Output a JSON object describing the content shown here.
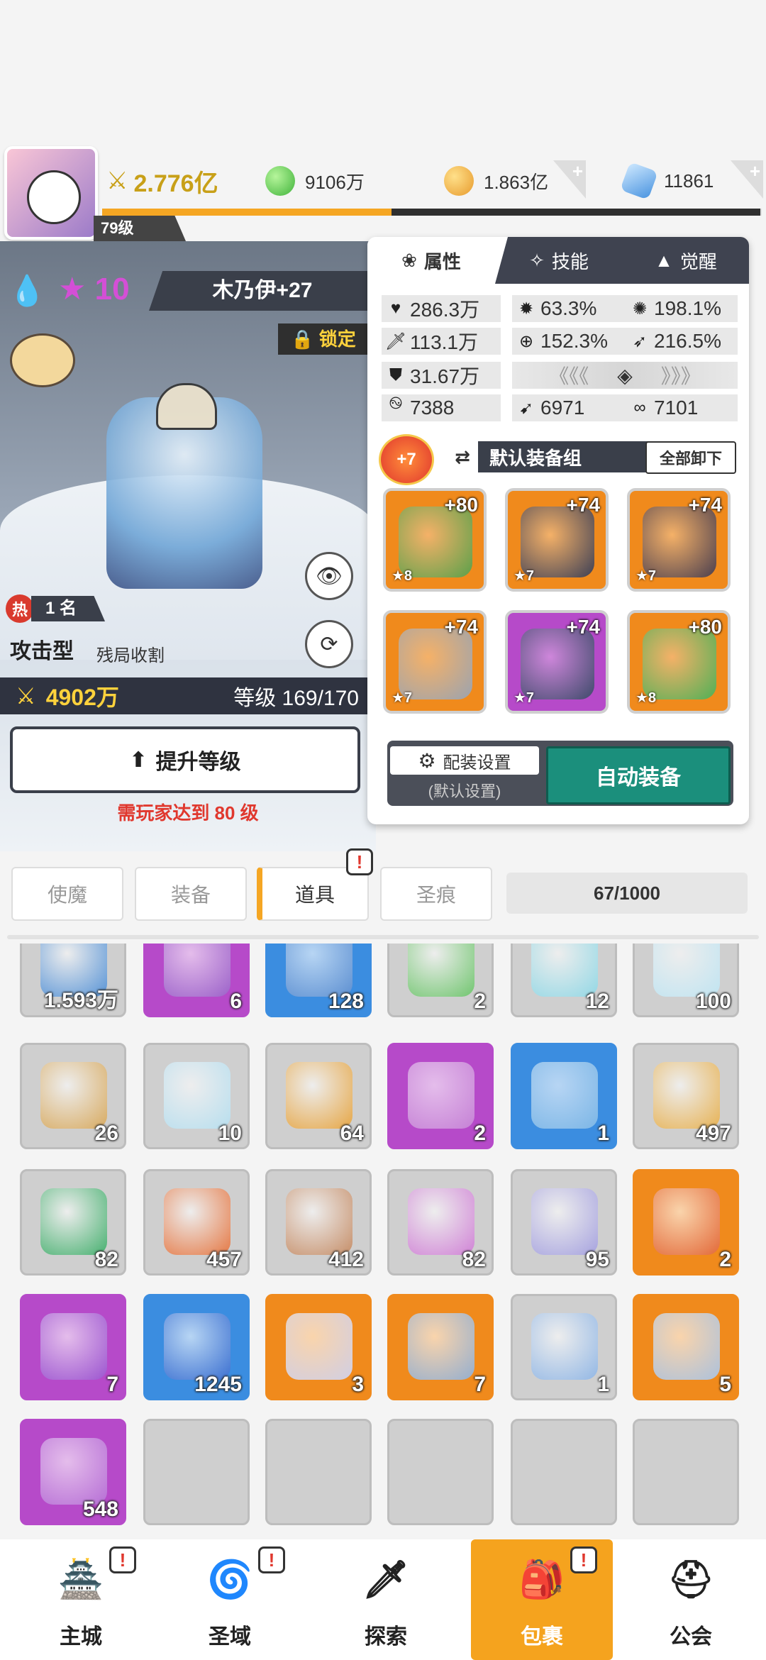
{
  "header": {
    "level": "79级",
    "power": "2.776亿",
    "currencies": [
      {
        "icon": "green-gem-icon",
        "value": "9106万"
      },
      {
        "icon": "gold-coin-icon",
        "value": "1.863亿"
      },
      {
        "icon": "blue-crystal-icon",
        "value": "11861"
      }
    ],
    "xp_progress": 0.5
  },
  "hero": {
    "stars": "10",
    "name": "木乃伊+27",
    "lock_label": "锁定",
    "rank_label": "热",
    "rank_value": "1 名",
    "type": "攻击型",
    "subtype": "残局收割",
    "power": "4902万",
    "level_text": "等级 169/170",
    "upgrade_label": "提升等级",
    "requirement": "需玩家达到 80 级"
  },
  "panel": {
    "tabs": [
      "属性",
      "技能",
      "觉醒"
    ],
    "stats": {
      "hp": "286.3万",
      "crit": "63.3%",
      "crit_dmg": "198.1%",
      "atk": "113.1万",
      "acc": "152.3%",
      "speed": "216.5%",
      "def": "31.67万",
      "s1": "7388",
      "s2": "6971",
      "s3": "7101"
    },
    "equip_badge": "+7",
    "equip_group": "默认装备组",
    "unequip_all": "全部卸下",
    "slots": [
      {
        "plus": "+80",
        "star": "★8",
        "frame": "#f08a1c",
        "art": "#5aa04a"
      },
      {
        "plus": "+74",
        "star": "★7",
        "frame": "#f08a1c",
        "art": "#3c3f55"
      },
      {
        "plus": "+74",
        "star": "★7",
        "frame": "#f08a1c",
        "art": "#4a3e4e"
      },
      {
        "plus": "+74",
        "star": "★7",
        "frame": "#f08a1c",
        "art": "#9aa3b0"
      },
      {
        "plus": "+74",
        "star": "★7",
        "frame": "#b64ac9",
        "art": "#3d4a6a"
      },
      {
        "plus": "+80",
        "star": "★8",
        "frame": "#f08a1c",
        "art": "#4fb056"
      }
    ],
    "config_label": "配装设置",
    "config_sub": "(默认设置)",
    "auto_equip": "自动装备"
  },
  "inventory": {
    "tabs": [
      "使魔",
      "装备",
      "道具",
      "圣痕"
    ],
    "active_tab": "道具",
    "capacity": "67/1000",
    "items": [
      {
        "count": "1.593万",
        "frame": "#d0d0d0",
        "art": "#4f8fd6"
      },
      {
        "count": "6",
        "frame": "#b64ac9",
        "art": "#9a63c9"
      },
      {
        "count": "128",
        "frame": "#3b8de0",
        "art": "#5e8fd0"
      },
      {
        "count": "2",
        "frame": "#d0d0d0",
        "art": "#6cc56a"
      },
      {
        "count": "12",
        "frame": "#d0d0d0",
        "art": "#8fd8e6"
      },
      {
        "count": "100",
        "frame": "#d0d0d0",
        "art": "#bfe5f3"
      },
      {
        "count": "26",
        "frame": "#d0d0d0",
        "art": "#d8a85a"
      },
      {
        "count": "10",
        "frame": "#d0d0d0",
        "art": "#b6dff0"
      },
      {
        "count": "64",
        "frame": "#d0d0d0",
        "art": "#e7a43e"
      },
      {
        "count": "2",
        "frame": "#b64ac9",
        "art": "#c684d6"
      },
      {
        "count": "1",
        "frame": "#3b8de0",
        "art": "#7fb8e6"
      },
      {
        "count": "497",
        "frame": "#d0d0d0",
        "art": "#e8b04c"
      },
      {
        "count": "82",
        "frame": "#d0d0d0",
        "art": "#3fae6a"
      },
      {
        "count": "457",
        "frame": "#d0d0d0",
        "art": "#e6733c"
      },
      {
        "count": "412",
        "frame": "#d0d0d0",
        "art": "#c58a62"
      },
      {
        "count": "82",
        "frame": "#d0d0d0",
        "art": "#d07ed6"
      },
      {
        "count": "95",
        "frame": "#d0d0d0",
        "art": "#a4a0e0"
      },
      {
        "count": "2",
        "frame": "#f08a1c",
        "art": "#e2673a"
      },
      {
        "count": "7",
        "frame": "#b64ac9",
        "art": "#9a55d0"
      },
      {
        "count": "1245",
        "frame": "#3b8de0",
        "art": "#3b6ed0"
      },
      {
        "count": "3",
        "frame": "#f08a1c",
        "art": "#cfd2ee"
      },
      {
        "count": "7",
        "frame": "#f08a1c",
        "art": "#8fb0d8"
      },
      {
        "count": "1",
        "frame": "#d0d0d0",
        "art": "#8fb6e6"
      },
      {
        "count": "5",
        "frame": "#f08a1c",
        "art": "#a8c4e6"
      },
      {
        "count": "548",
        "frame": "#b64ac9",
        "art": "#b670d6"
      },
      {
        "count": "",
        "frame": "#d0d0d0",
        "art": ""
      },
      {
        "count": "",
        "frame": "#d0d0d0",
        "art": ""
      },
      {
        "count": "",
        "frame": "#d0d0d0",
        "art": ""
      },
      {
        "count": "",
        "frame": "#d0d0d0",
        "art": ""
      },
      {
        "count": "",
        "frame": "#d0d0d0",
        "art": ""
      }
    ]
  },
  "nav": [
    {
      "label": "主城",
      "icon": "castle-icon",
      "badge": "!"
    },
    {
      "label": "圣域",
      "icon": "vortex-icon",
      "badge": "!"
    },
    {
      "label": "探索",
      "icon": "sword-icon",
      "badge": ""
    },
    {
      "label": "包裹",
      "icon": "bag-icon",
      "badge": "!"
    },
    {
      "label": "公会",
      "icon": "guild-helmet-icon",
      "badge": ""
    }
  ],
  "colors": {
    "accent_orange": "#f5a623",
    "auto_equip_green": "#1b8f7c",
    "nav_active": "#f5a31e"
  }
}
